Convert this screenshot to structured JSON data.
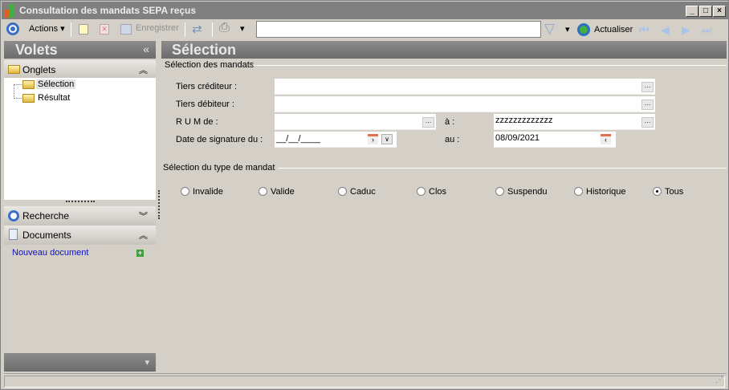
{
  "window": {
    "title": "Consultation des mandats SEPA reçus",
    "minimize": "_",
    "maximize": "□",
    "close": "×"
  },
  "toolbar": {
    "actions": "Actions",
    "save": "Enregistrer",
    "search_value": "",
    "refresh": "Actualiser"
  },
  "volets": {
    "title": "Volets",
    "collapse": "«",
    "onglets": {
      "label": "Onglets",
      "items": [
        "Sélection",
        "Résultat"
      ]
    },
    "recherche": {
      "label": "Recherche"
    },
    "documents": {
      "label": "Documents",
      "new_doc": "Nouveau document"
    }
  },
  "main": {
    "title": "Sélection",
    "section1": "Sélection des mandats",
    "fields": {
      "tiers_crediteur": {
        "label": "Tiers créditeur :",
        "value": ""
      },
      "tiers_debiteur": {
        "label": "Tiers débiteur :",
        "value": ""
      },
      "rum_de": {
        "label": "R U M de  :",
        "value": ""
      },
      "rum_a": {
        "label": "à :",
        "value": "zzzzzzzzzzzzz"
      },
      "date_du": {
        "label": "Date de signature du :",
        "value": "__/__/____"
      },
      "date_au": {
        "label": "au :",
        "value": "08/09/2021"
      }
    },
    "section2": "Sélection du type de mandat",
    "types": [
      {
        "label": "Invalide",
        "checked": false
      },
      {
        "label": "Valide",
        "checked": false
      },
      {
        "label": "Caduc",
        "checked": false
      },
      {
        "label": "Clos",
        "checked": false
      },
      {
        "label": "Suspendu",
        "checked": false
      },
      {
        "label": "Historique",
        "checked": false
      },
      {
        "label": "Tous",
        "checked": true
      }
    ]
  }
}
